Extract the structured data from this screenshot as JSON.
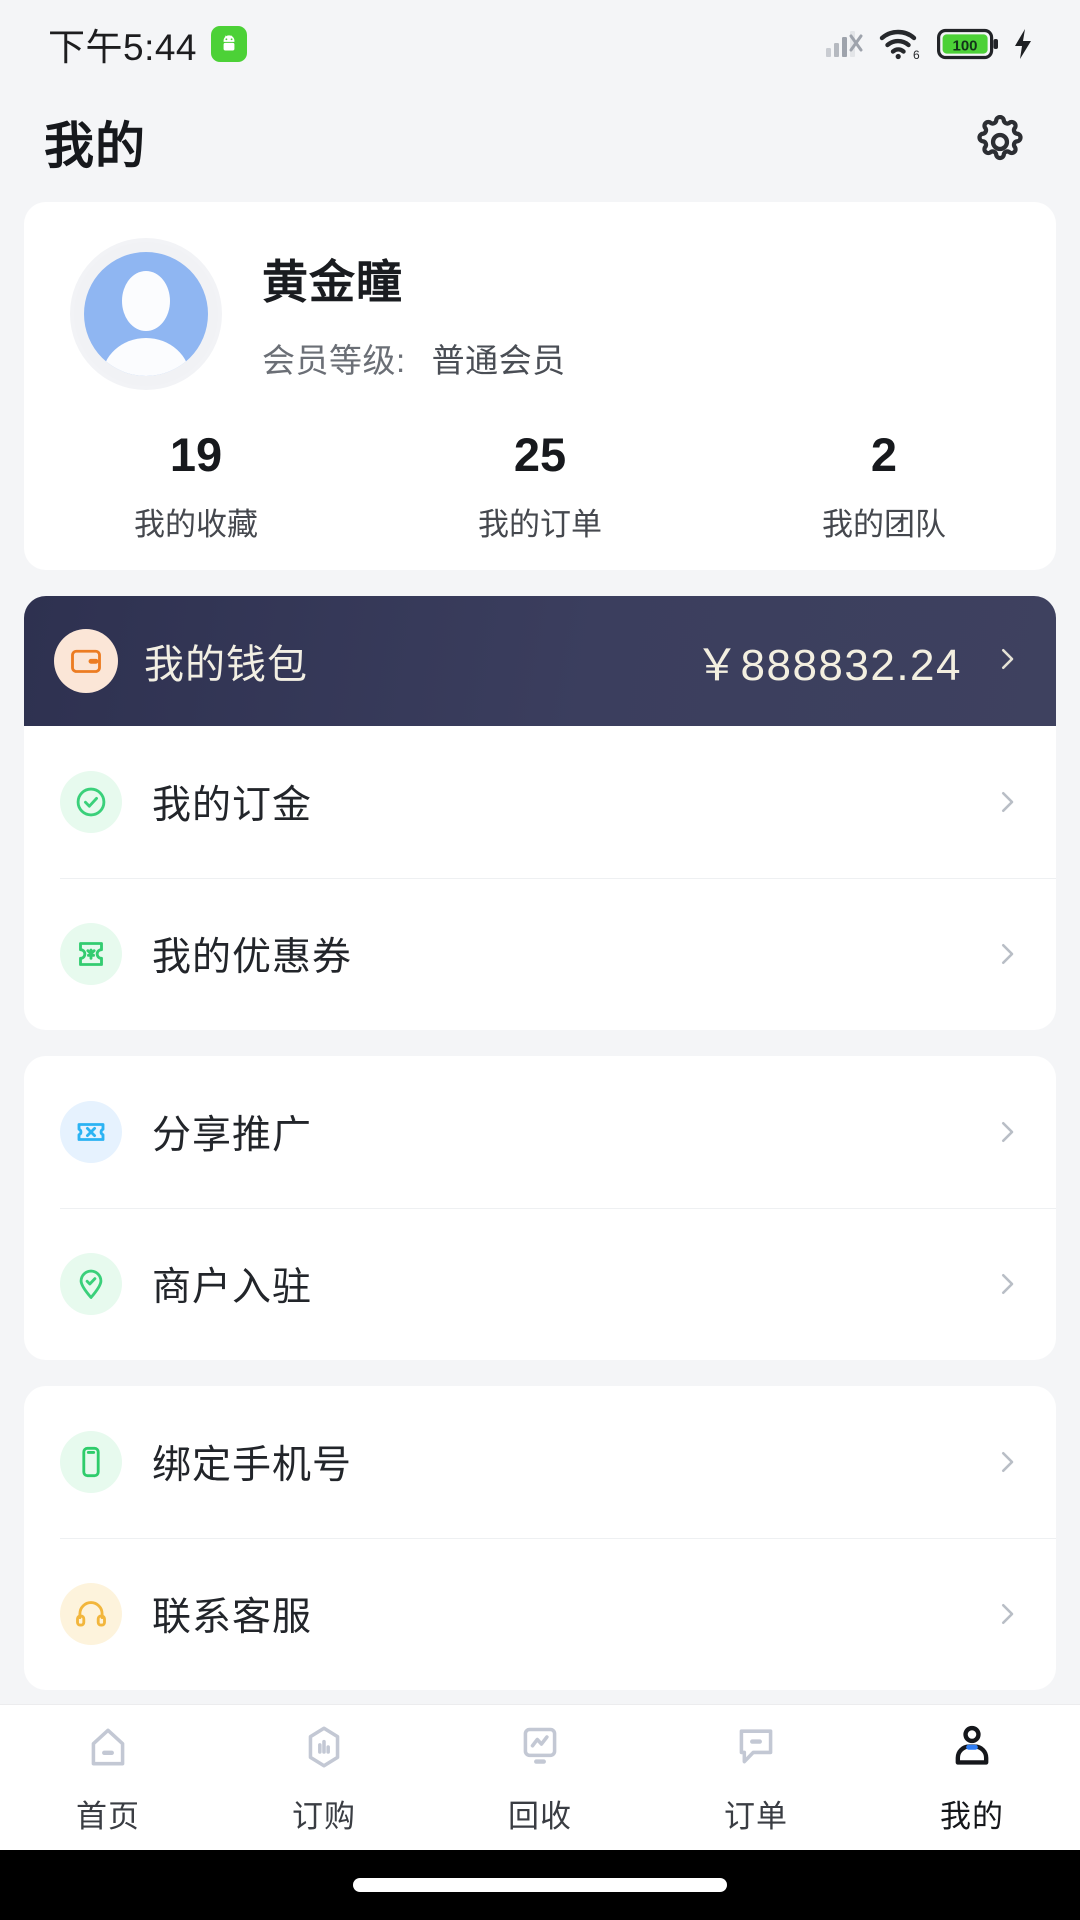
{
  "status_bar": {
    "time": "下午5:44",
    "icons": [
      "android-robot-icon",
      "cellular-signal-off-icon",
      "wifi-6-icon",
      "battery-icon",
      "charging-bolt-icon"
    ],
    "battery_level": "100"
  },
  "header": {
    "title": "我的",
    "settings_icon": "gear-icon"
  },
  "profile": {
    "avatar_icon": "user-avatar-icon",
    "name": "黄金瞳",
    "level_label": "会员等级:",
    "level_value": "普通会员",
    "stats": [
      {
        "value": "19",
        "label": "我的收藏"
      },
      {
        "value": "25",
        "label": "我的订单"
      },
      {
        "value": "2",
        "label": "我的团队"
      }
    ]
  },
  "wallet": {
    "icon": "wallet-icon",
    "label": "我的钱包",
    "amount": "￥888832.24",
    "chevron": "chevron-right-icon"
  },
  "menu_groups": [
    {
      "items": [
        {
          "label": "我的订金",
          "icon": "check-circle-icon",
          "icon_bg": "#e7faee",
          "icon_color": "#3ad07a"
        },
        {
          "label": "我的优惠券",
          "icon": "coupon-icon",
          "icon_bg": "#e7faee",
          "icon_color": "#33cc70"
        }
      ]
    },
    {
      "items": [
        {
          "label": "分享推广",
          "icon": "ticket-icon",
          "icon_bg": "#e6f2fe",
          "icon_color": "#2bb3f3"
        },
        {
          "label": "商户入驻",
          "icon": "location-check-icon",
          "icon_bg": "#e7faee",
          "icon_color": "#3ad07a"
        }
      ]
    },
    {
      "items": [
        {
          "label": "绑定手机号",
          "icon": "phone-icon",
          "icon_bg": "#e7faee",
          "icon_color": "#2ecc6b"
        },
        {
          "label": "联系客服",
          "icon": "headset-icon",
          "icon_bg": "#fdf3dc",
          "icon_color": "#f2b63c"
        }
      ]
    }
  ],
  "tabbar": {
    "items": [
      {
        "label": "首页",
        "icon": "home-icon",
        "active": false
      },
      {
        "label": "订购",
        "icon": "chart-hexagon-icon",
        "active": false
      },
      {
        "label": "回收",
        "icon": "monitor-line-icon",
        "active": false
      },
      {
        "label": "订单",
        "icon": "speech-bubble-icon",
        "active": false
      },
      {
        "label": "我的",
        "icon": "person-icon",
        "active": true
      }
    ]
  },
  "colors": {
    "page_bg": "#f4f5f7",
    "card_bg": "#ffffff",
    "wallet_bg_dark": "#2e3150",
    "wallet_text": "#f3efe0",
    "accent_blue": "#2f7ef5",
    "tab_inactive": "#c3c8d4",
    "tab_active": "#15171b"
  }
}
